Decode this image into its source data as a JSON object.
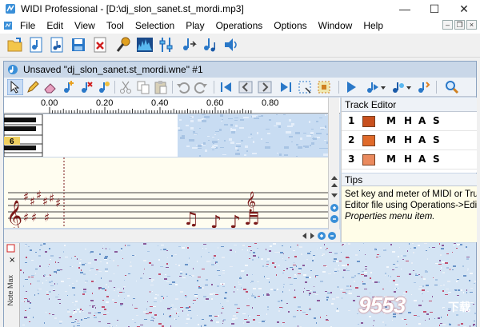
{
  "window": {
    "title": "WIDI Professional - [D:\\dj_slon_sanet.st_mordi.mp3]",
    "minimize_glyph": "—",
    "maximize_glyph": "☐",
    "close_glyph": "✕"
  },
  "menubar": {
    "items": [
      "File",
      "Edit",
      "View",
      "Tool",
      "Selection",
      "Play",
      "Operations",
      "Options",
      "Window",
      "Help"
    ],
    "mdi_minimize": "–",
    "mdi_restore": "❐",
    "mdi_close": "×"
  },
  "toolbar": {
    "icons": [
      "open-file-icon",
      "audio-file-icon",
      "midi-file-icon",
      "save-icon",
      "close-file-icon",
      "microphone-icon",
      "spectrum-icon",
      "mixer-icon",
      "recognize-icon",
      "convert-icon",
      "speaker-icon"
    ]
  },
  "document": {
    "title": "Unsaved \"dj_slon_sanet.st_mordi.wne\" #1"
  },
  "ruler": {
    "ticks": [
      "0.00",
      "0.20",
      "0.40",
      "0.60",
      "0.80"
    ]
  },
  "piano": {
    "key_label": "6"
  },
  "track_editor": {
    "title": "Track Editor",
    "tracks": [
      {
        "num": "1",
        "color": "#c8501e",
        "flags": [
          "M",
          "H",
          "A",
          "S"
        ]
      },
      {
        "num": "2",
        "color": "#e06a2a",
        "flags": [
          "M",
          "H",
          "A",
          "S"
        ]
      },
      {
        "num": "3",
        "color": "#ea8a5e",
        "flags": [
          "M",
          "H",
          "A",
          "S"
        ]
      }
    ]
  },
  "tips": {
    "title": "Tips",
    "line1": "Set key and meter of MIDI or Tru",
    "line2": "Editor file using Operations->Edit",
    "line3": "Properties menu item."
  },
  "spectrogram": {
    "side_label": "Note Max"
  },
  "watermark": {
    "text": "9553",
    "sub": "下载"
  },
  "colors": {
    "doc_frame": "#c9d7e8",
    "notation_bg": "#fffdf0",
    "note_color": "#8b1a1a",
    "spectro_bg": "#d4e4f4"
  }
}
